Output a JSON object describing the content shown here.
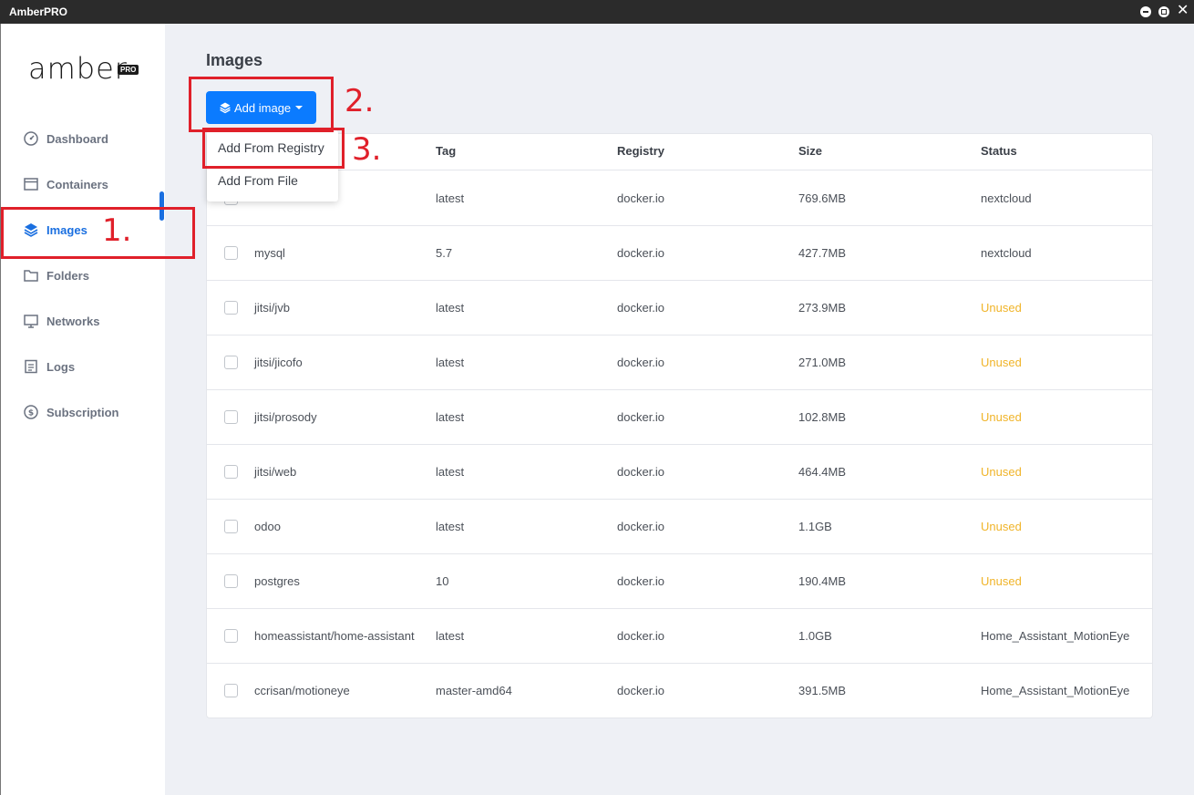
{
  "window": {
    "title": "AmberPRO"
  },
  "brand": {
    "name": "amber",
    "badge": "PRO"
  },
  "sidebar": {
    "items": [
      {
        "label": "Dashboard",
        "icon": "dashboard-gauge-icon"
      },
      {
        "label": "Containers",
        "icon": "container-box-icon"
      },
      {
        "label": "Images",
        "icon": "layers-icon",
        "active": true
      },
      {
        "label": "Folders",
        "icon": "folder-icon"
      },
      {
        "label": "Networks",
        "icon": "monitor-icon"
      },
      {
        "label": "Logs",
        "icon": "log-notebook-icon"
      },
      {
        "label": "Subscription",
        "icon": "dollar-circle-icon"
      }
    ]
  },
  "main": {
    "title": "Images",
    "add_button": {
      "label": "Add image",
      "icon": "layers-icon"
    },
    "dropdown": [
      "Add From Registry",
      "Add From File"
    ],
    "columns": [
      "Tag",
      "Registry",
      "Size",
      "Status"
    ],
    "rows": [
      {
        "name": "",
        "tag": "latest",
        "registry": "docker.io",
        "size": "769.6MB",
        "status": "nextcloud"
      },
      {
        "name": "mysql",
        "tag": "5.7",
        "registry": "docker.io",
        "size": "427.7MB",
        "status": "nextcloud"
      },
      {
        "name": "jitsi/jvb",
        "tag": "latest",
        "registry": "docker.io",
        "size": "273.9MB",
        "status": "Unused"
      },
      {
        "name": "jitsi/jicofo",
        "tag": "latest",
        "registry": "docker.io",
        "size": "271.0MB",
        "status": "Unused"
      },
      {
        "name": "jitsi/prosody",
        "tag": "latest",
        "registry": "docker.io",
        "size": "102.8MB",
        "status": "Unused"
      },
      {
        "name": "jitsi/web",
        "tag": "latest",
        "registry": "docker.io",
        "size": "464.4MB",
        "status": "Unused"
      },
      {
        "name": "odoo",
        "tag": "latest",
        "registry": "docker.io",
        "size": "1.1GB",
        "status": "Unused"
      },
      {
        "name": "postgres",
        "tag": "10",
        "registry": "docker.io",
        "size": "190.4MB",
        "status": "Unused"
      },
      {
        "name": "homeassistant/home-assistant",
        "tag": "latest",
        "registry": "docker.io",
        "size": "1.0GB",
        "status": "Home_Assistant_MotionEye"
      },
      {
        "name": "ccrisan/motioneye",
        "tag": "master-amd64",
        "registry": "docker.io",
        "size": "391.5MB",
        "status": "Home_Assistant_MotionEye"
      }
    ]
  },
  "annotations": [
    "1.",
    "2.",
    "3."
  ],
  "colors": {
    "accent": "#0b7bff",
    "unused": "#f0b429",
    "annotation": "#e0202a"
  }
}
